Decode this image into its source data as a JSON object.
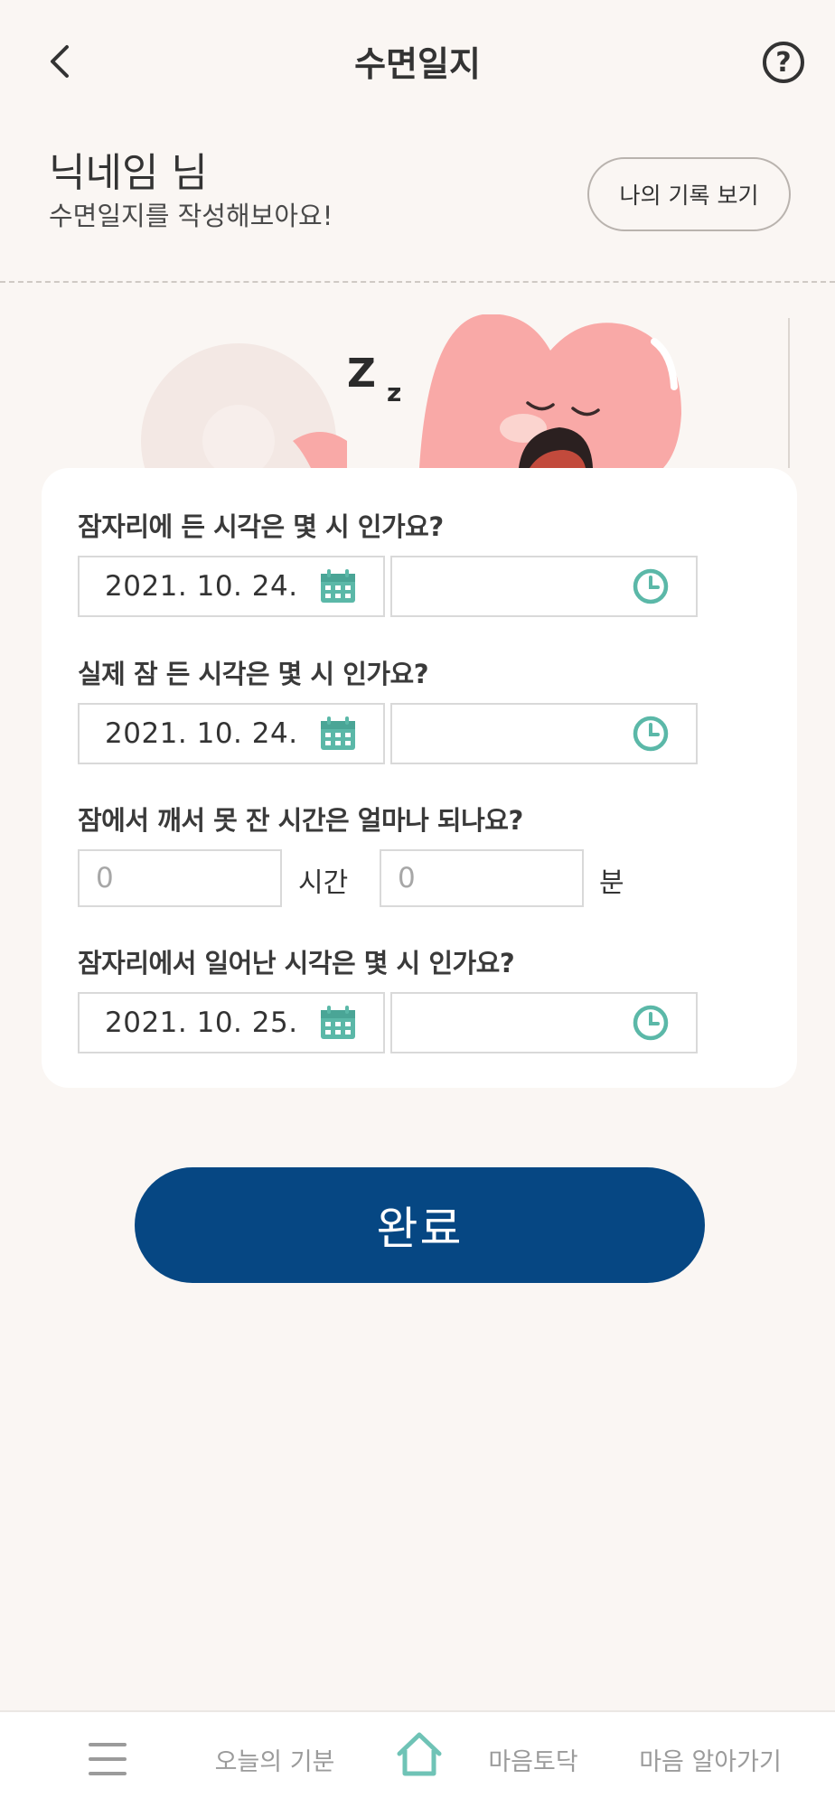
{
  "header": {
    "title": "수면일지",
    "back_icon": "chevron-left-icon",
    "help_label": "?"
  },
  "greeting": {
    "name": "닉네임 님",
    "subtitle": "수면일지를 작성해보아요!",
    "records_button": "나의 기록 보기"
  },
  "illustration": {
    "zz_big": "Z",
    "zz_small": "z"
  },
  "form": {
    "bedtime": {
      "label": "잠자리에 든 시각은 몇 시 인가요?",
      "date": "2021. 10. 24.",
      "time": ""
    },
    "sleep_start": {
      "label": "실제 잠 든 시각은 몇 시 인가요?",
      "date": "2021. 10. 24.",
      "time": ""
    },
    "awake_duration": {
      "label": "잠에서 깨서 못 잔 시간은 얼마나 되나요?",
      "hours_placeholder": "0",
      "hours_unit": "시간",
      "minutes_placeholder": "0",
      "minutes_unit": "분"
    },
    "wake_up": {
      "label": "잠자리에서 일어난 시각은 몇 시 인가요?",
      "date": "2021. 10. 25.",
      "time": ""
    }
  },
  "submit_label": "완료",
  "bottom_nav": {
    "items": [
      {
        "label": "오늘의 기분"
      },
      {
        "label": "마음토닥"
      },
      {
        "label": "마음 알아가기"
      }
    ]
  },
  "colors": {
    "primary": "#064783",
    "accent_teal": "#5bb8a8",
    "background": "#faf6f3",
    "heart": "#f9a9a7"
  }
}
